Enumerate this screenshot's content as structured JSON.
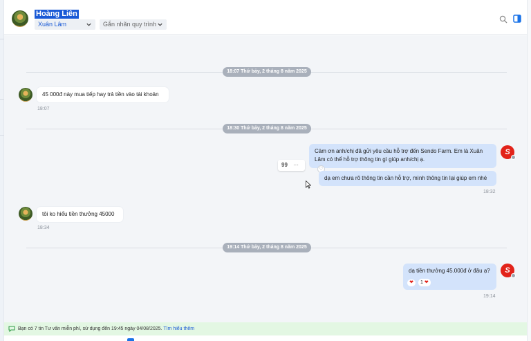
{
  "header": {
    "customer_name": "Hoàng Liên",
    "agent_name": "Xuân Lâm",
    "tag_placeholder": "Gắn nhãn quy trình",
    "search_icon": "search-icon",
    "panel_icon": "side-panel-icon"
  },
  "conversation": {
    "date_1": "18:07 Thứ bảy, 2 tháng 8 năm 2025",
    "msg_1_text": "45 000đ này mua tiếp hay trả tiền vào tài khoản",
    "msg_1_time": "18:07",
    "date_2": "18:30 Thứ bảy, 2 tháng 8 năm 2025",
    "msg_2_text": "Cảm ơn anh/chị đã gửi yêu cầu hỗ trợ đến Sendo Farm. Em là Xuân Lâm có thể hỗ trợ thông tin gì giúp anh/chị ạ.",
    "msg_3_text": "dạ em chưa rõ thông tin cần hỗ trợ, mình thông tin lại giúp em nhé",
    "msg_3_time": "18:32",
    "msg_4_text": "tôi ko hiểu tiền thưởng 45000",
    "msg_4_time": "18:34",
    "date_3": "19:14 Thứ bảy, 2 tháng 8 năm 2025",
    "msg_5_text": "dạ tiền thưởng 45.000đ ở đâu ạ?",
    "msg_5_reaction_count": "1",
    "msg_5_time": "19:14",
    "brand_logo_letter": "S"
  },
  "action_bar": {
    "quote_symbol": "99",
    "more_symbol": "···"
  },
  "footer": {
    "notice": "Bạn có 7 tin Tư vấn miễn phí, sử dụng đến 19:45 ngày 04/08/2025.",
    "link": "Tìm hiểu thêm"
  },
  "colors": {
    "accent": "#1a5ad6",
    "outgoing_bubble": "#d3e3fb",
    "brand": "#e2231a",
    "footer_bg": "#e3f7e3"
  }
}
